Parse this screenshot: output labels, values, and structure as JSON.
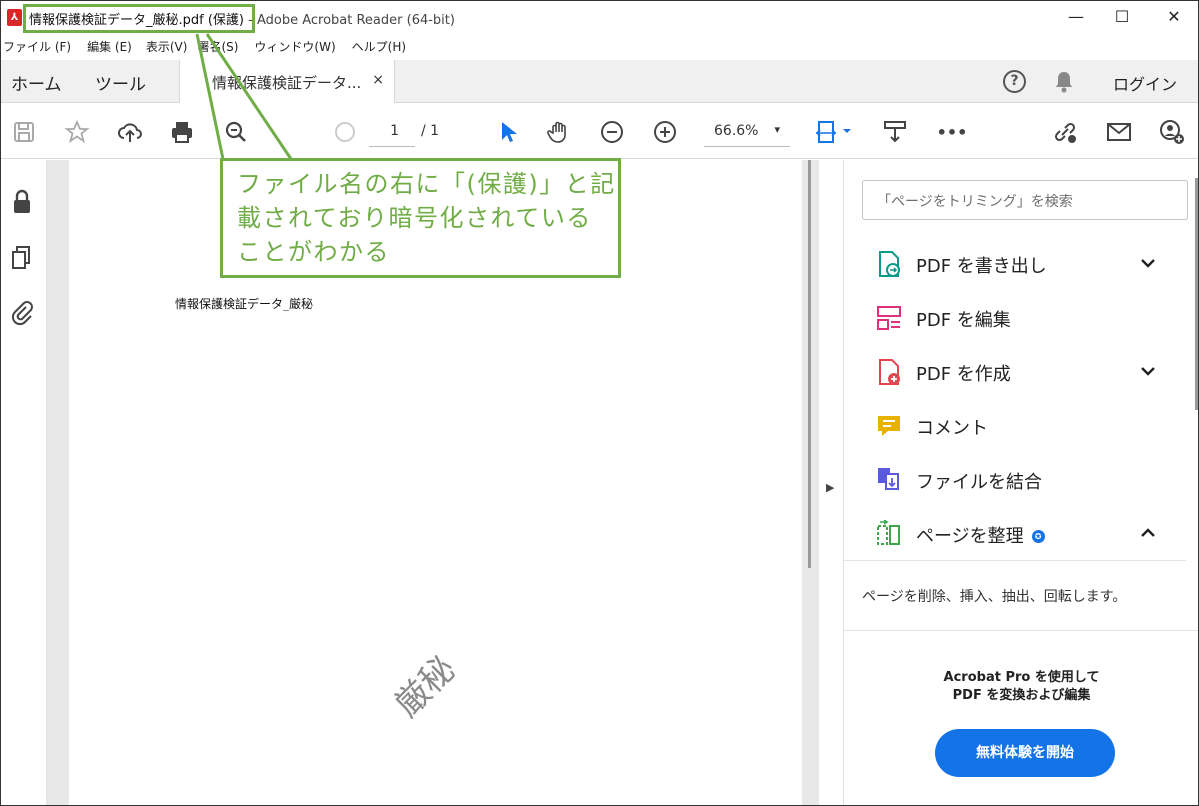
{
  "window": {
    "title": "情報保護検証データ_厳秘.pdf (保護)",
    "title_suffix": " - Adobe Acrobat Reader (64-bit)",
    "app_icon": "pdf-icon",
    "controls": {
      "minimize": "—",
      "maximize": "☐",
      "close": "✕"
    }
  },
  "menu": [
    "ファイル (F)",
    "編集 (E)",
    "表示(V)",
    "署名(S)",
    "ウィンドウ(W)",
    "ヘルプ(H)"
  ],
  "tabs": {
    "home": "ホーム",
    "tools": "ツール",
    "document": "情報保護検証データ...",
    "document_close": "×",
    "login": "ログイン",
    "help": "?"
  },
  "toolbar": {
    "page_current": "1",
    "page_total": "/ 1",
    "zoom": "66.6%",
    "zoom_caret": "▾",
    "more": "•••"
  },
  "document": {
    "heading": "情報保護検証データ_厳秘",
    "watermark": "厳秘"
  },
  "right_panel": {
    "search_placeholder": "「ページをトリミング」を検索",
    "tools": [
      {
        "label": "PDF を書き出し",
        "icon": "export-pdf-icon",
        "color": "#0a9a8a",
        "chevron": "⌄"
      },
      {
        "label": "PDF を編集",
        "icon": "edit-pdf-icon",
        "color": "#e0307c",
        "chevron": ""
      },
      {
        "label": "PDF を作成",
        "icon": "create-pdf-icon",
        "color": "#e34850",
        "chevron": "⌄"
      },
      {
        "label": "コメント",
        "icon": "comment-icon",
        "color": "#e8b300",
        "chevron": ""
      },
      {
        "label": "ファイルを結合",
        "icon": "combine-files-icon",
        "color": "#5a5adf",
        "chevron": ""
      },
      {
        "label": "ページを整理",
        "icon": "organize-pages-icon",
        "color": "#3da74e",
        "chevron": "⌃",
        "badge": "✪"
      }
    ],
    "organize_description": "ページを削除、挿入、抽出、回転します。",
    "promo_line1": "Acrobat Pro を使用して",
    "promo_line2": "PDF を変換および編集",
    "promo_button": "無料体験を開始"
  },
  "annotation": {
    "callout": "ファイル名の右に「(保護)」と記載されており暗号化されていることがわかる",
    "color": "#70ad47"
  }
}
